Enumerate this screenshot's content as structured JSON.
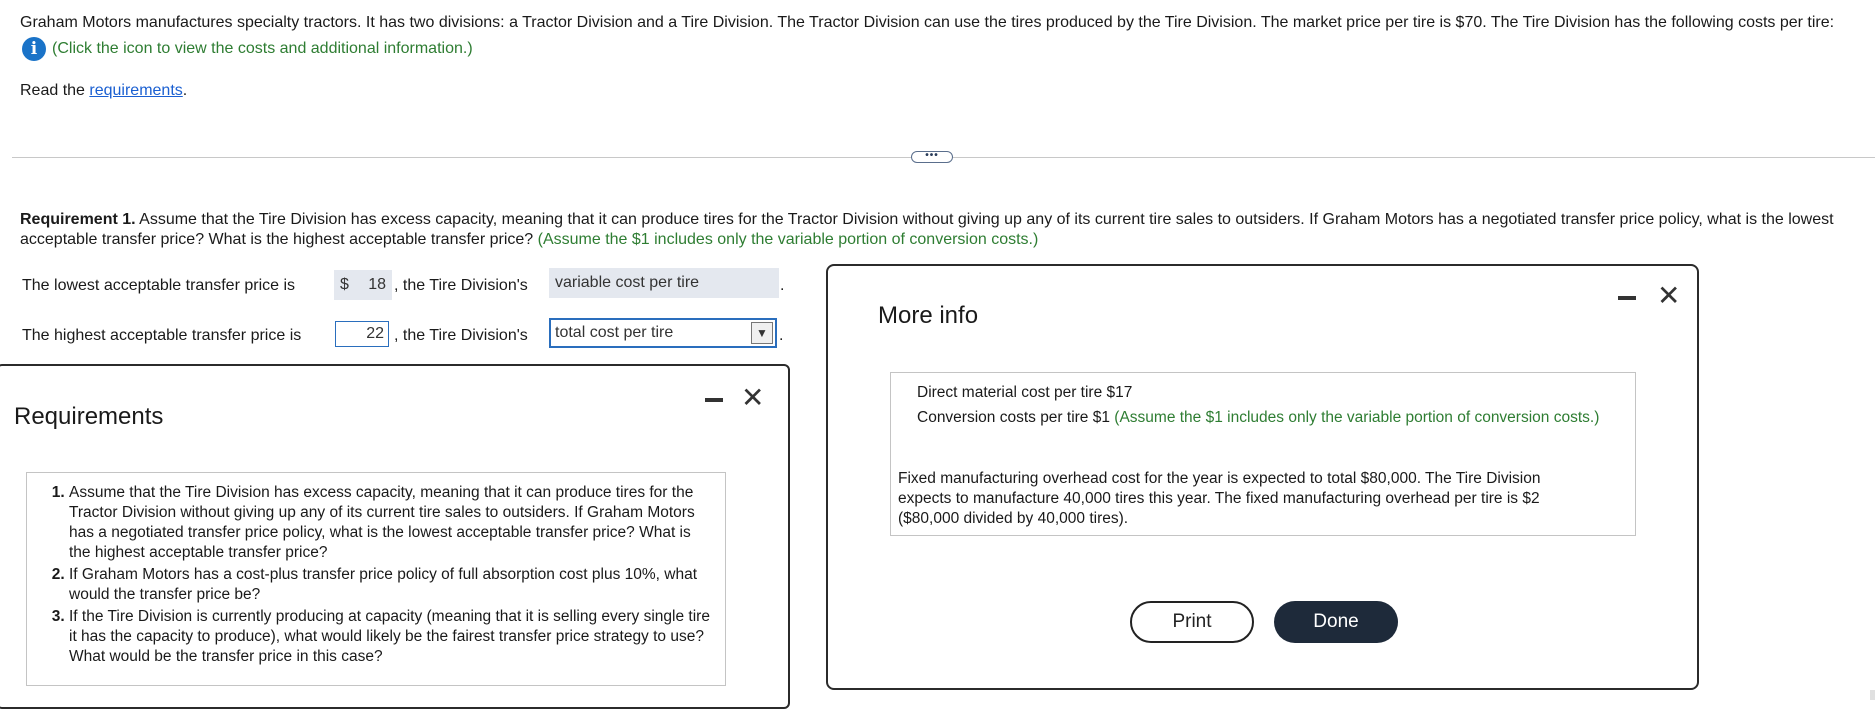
{
  "intro": {
    "text": "Graham Motors manufactures specialty tractors. It has two divisions: a Tractor Division and a Tire Division. The Tractor Division can use the tires produced by the Tire Division. The market price per tire is $70. The Tire Division has the following costs per tire:",
    "info_icon_glyph": "i",
    "info_text": "(Click the icon to view the costs and additional information.)"
  },
  "read_line": {
    "prefix": "Read the ",
    "link": "requirements",
    "suffix": "."
  },
  "expander": "•••",
  "requirement1": {
    "label": "Requirement 1.",
    "text": " Assume that the Tire Division has excess capacity, meaning that it can produce tires for the Tractor Division without giving up any of its current tire sales to outsiders. If Graham Motors has a negotiated transfer price policy, what is the lowest acceptable transfer price? What is the highest acceptable transfer price?",
    "note": "(Assume the $1 includes only the variable portion of conversion costs.)"
  },
  "answers": {
    "lowest": {
      "label": "The lowest acceptable transfer price is",
      "currency": "$",
      "value": "18",
      "mid_text": ", the Tire Division's",
      "basis": "variable cost per tire",
      "end": "."
    },
    "highest": {
      "label": "The highest acceptable transfer price is",
      "value": "22",
      "mid_text": ", the Tire Division's",
      "basis": "total cost per tire",
      "arrow": "▼",
      "end": "."
    }
  },
  "requirements_panel": {
    "title": "Requirements",
    "close": "✕",
    "items": [
      "Assume that the Tire Division has excess capacity, meaning that it can produce tires for the Tractor Division without giving up any of its current tire sales to outsiders. If Graham Motors has a negotiated transfer price policy, what is the lowest acceptable transfer price? What is the highest acceptable transfer price?",
      "If Graham Motors has a cost-plus transfer price policy of full absorption cost plus 10%, what would the transfer price be?",
      "If the Tire Division is currently producing at capacity (meaning that it is selling every single tire it has the capacity to produce), what would likely be the fairest transfer price strategy to use? What would be the transfer price in this case?"
    ]
  },
  "more_info_panel": {
    "title": "More info",
    "close": "✕",
    "direct_material": "Direct material cost per tire $17",
    "conversion_prefix": "Conversion costs per tire $1 ",
    "conversion_note": "(Assume the $1 includes only the variable portion of conversion costs.)",
    "fixed_overhead": "Fixed manufacturing overhead cost for the year is expected to total $80,000. The Tire Division expects to manufacture 40,000 tires this year. The fixed manufacturing overhead per tire is $2 ($80,000 divided by 40,000 tires).",
    "print_label": "Print",
    "done_label": "Done"
  },
  "colors": {
    "note_green": "#2e7d32",
    "link_blue": "#1a5fd1",
    "info_icon_blue": "#1a73c8",
    "done_button": "#1e2a3a"
  }
}
